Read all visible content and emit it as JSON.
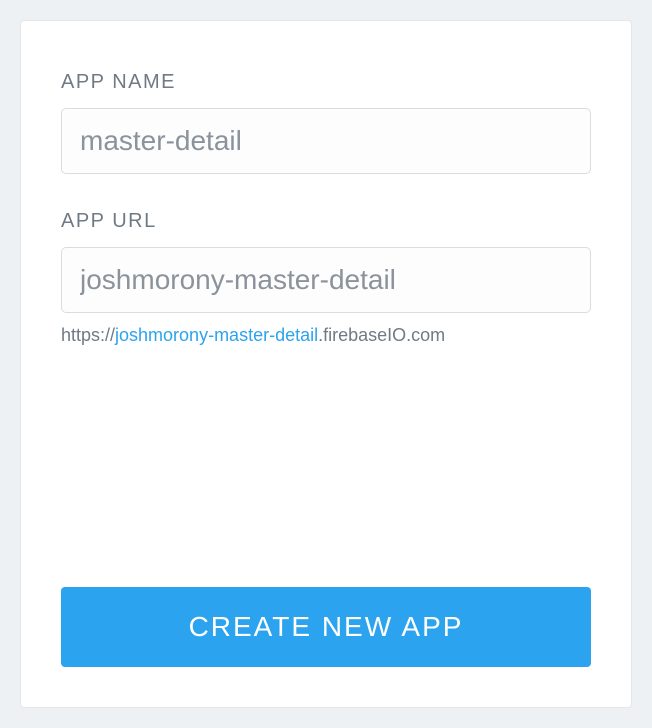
{
  "form": {
    "appName": {
      "label": "APP NAME",
      "value": "master-detail"
    },
    "appUrl": {
      "label": "APP URL",
      "value": "joshmorony-master-detail",
      "helperPrefix": "https://",
      "helperHighlight": "joshmorony-master-detail",
      "helperSuffix": ".firebaseIO.com"
    },
    "submitLabel": "CREATE NEW APP"
  }
}
